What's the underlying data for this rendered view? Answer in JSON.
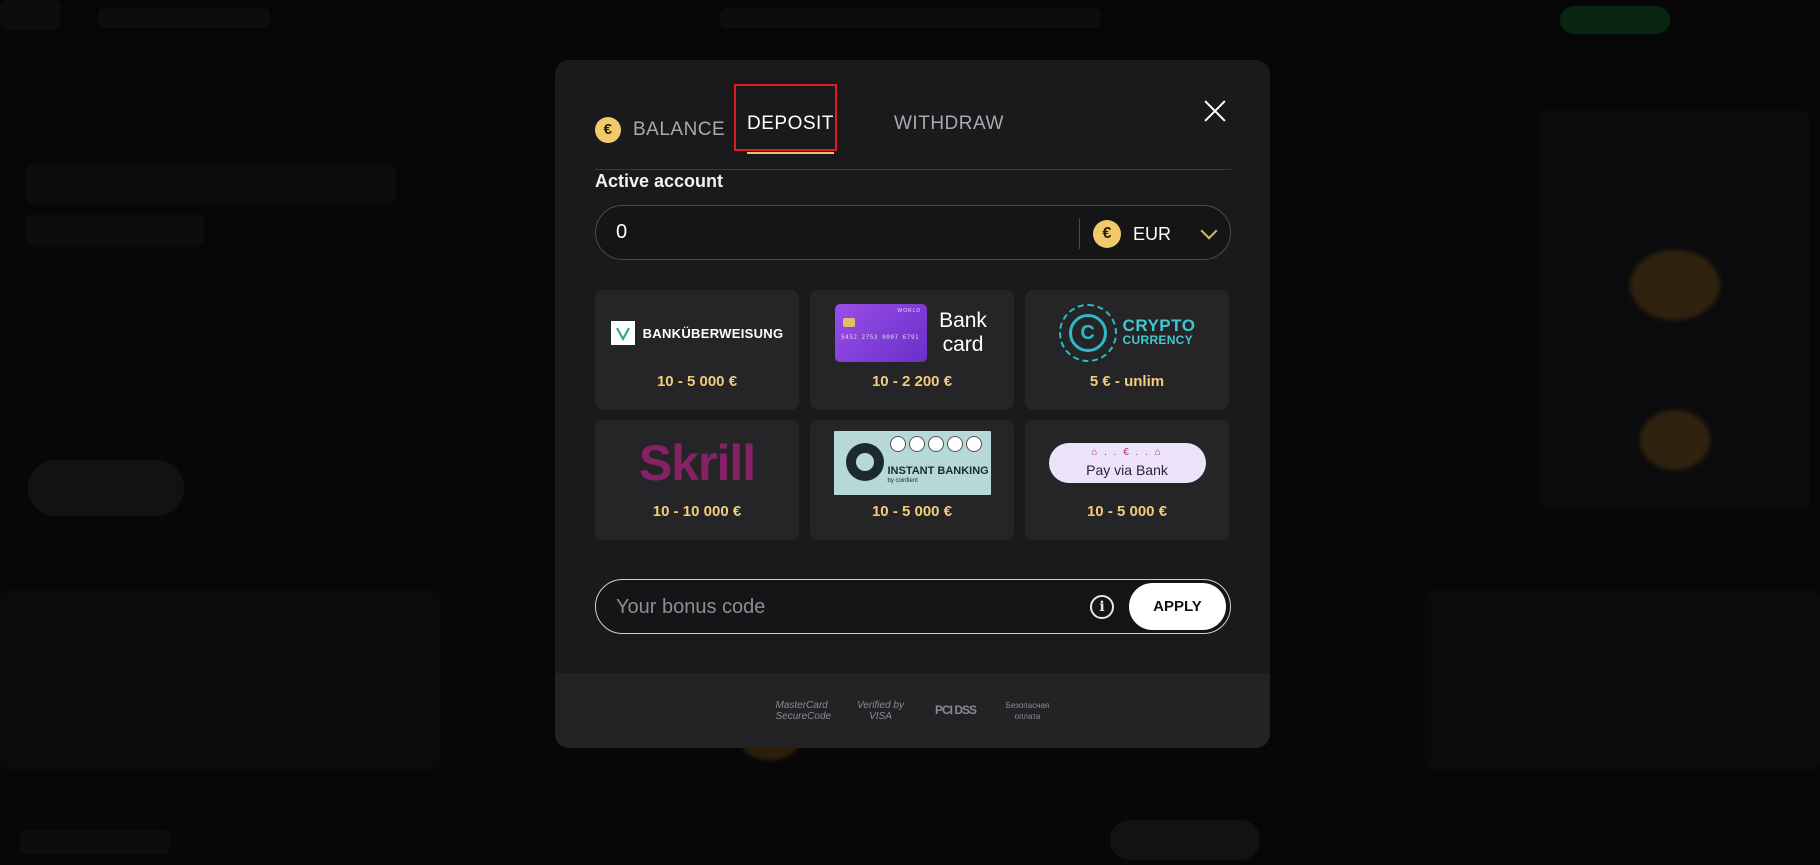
{
  "tabs": {
    "balance": "BALANCE",
    "deposit": "DEPOSIT",
    "withdraw": "WITHDRAW",
    "active": "deposit"
  },
  "account": {
    "label": "Active account",
    "value": "0",
    "currency": "EUR",
    "currency_symbol": "€"
  },
  "payment_methods": [
    {
      "name": "BANKÜBERWEISUNG",
      "range": "10 - 5 000 €",
      "icon": "sepa-logo-icon"
    },
    {
      "name": "Bank card",
      "range": "10 - 2 200 €",
      "icon": "credit-card-icon",
      "card_number": "5452 2753 0007 6791",
      "card_brand": "WORLD"
    },
    {
      "name": "CRYPTO CURRENCY",
      "range": "5 € - unlim",
      "icon": "crypto-coin-icon",
      "line1": "CRYPTO",
      "line2": "CURRENCY"
    },
    {
      "name": "Skrill",
      "range": "10 - 10 000 €",
      "icon": "skrill-logo-icon"
    },
    {
      "name": "INSTANT BANKING",
      "range": "10 - 5 000 €",
      "icon": "instant-banking-logo-icon",
      "sub": "by coinfient"
    },
    {
      "name": "Pay via Bank",
      "range": "10 - 5 000 €",
      "icon": "pay-via-bank-logo-icon"
    }
  ],
  "bonus": {
    "placeholder": "Your bonus code",
    "apply_label": "APPLY"
  },
  "footer_badges": [
    "MasterCard SecureCode",
    "Verified by VISA",
    "PCI DSS",
    "Безопасная оплата"
  ],
  "colors": {
    "accent_gold": "#f1cc7a",
    "highlight_red": "#e11b22",
    "skrill_purple": "#862165",
    "crypto_teal": "#2fb9c6"
  }
}
